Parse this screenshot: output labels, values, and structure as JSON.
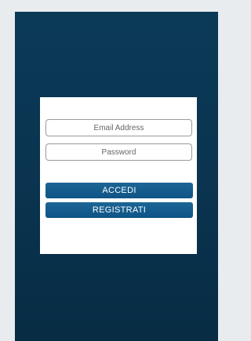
{
  "login_form": {
    "email_placeholder": "Email Address",
    "password_placeholder": "Password",
    "login_button_label": "ACCEDI",
    "register_button_label": "REGISTRATI"
  },
  "colors": {
    "background": "#0a3450",
    "button": "#135b8c",
    "card": "#ffffff"
  }
}
